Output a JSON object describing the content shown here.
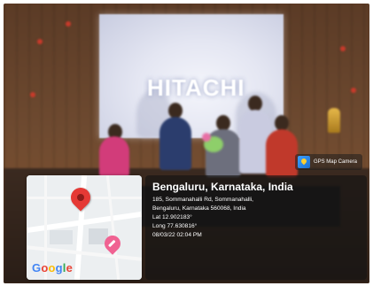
{
  "screen": {
    "logo_text": "HITACHI"
  },
  "overlay": {
    "brand": {
      "label": "GPS Map Camera",
      "icon": "gps-map-camera-icon"
    },
    "map": {
      "wordmark": "Google",
      "pin_primary_icon": "map-pin-icon",
      "pin_secondary_icon": "place-pin-icon",
      "colors": {
        "pin_primary": "#e53935",
        "pin_secondary": "#f06292"
      }
    },
    "location": {
      "title": "Bengaluru, Karnataka, India",
      "address_line_1": "185, Sommanahalli Rd, Sommanahalli,",
      "address_line_2": "Bengaluru, Karnataka 560068, India",
      "latitude": "Lat 12.902183°",
      "longitude": "Long 77.630816°",
      "timestamp": "08/03/22 02:04 PM"
    }
  }
}
